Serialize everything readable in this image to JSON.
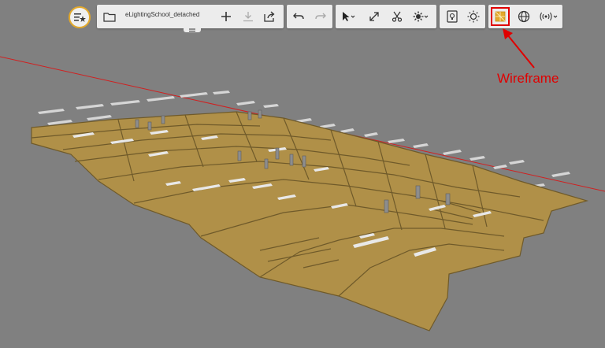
{
  "document": {
    "name": "eLightingSchool_detached"
  },
  "annotation": {
    "label": "Wireframe"
  },
  "colors": {
    "background": "#808080",
    "floor": "#b09048",
    "floor_edge": "#6f5a2a",
    "toolbar": "#ececec",
    "accent": "#e3a92b",
    "highlight": "#e00000"
  },
  "toolbar": {
    "menu": {
      "icon": "menu-star-icon"
    },
    "file": [
      "folder-icon",
      "add-icon",
      "download-icon",
      "export-icon"
    ],
    "edit": [
      "undo-icon",
      "redo-icon"
    ],
    "tools": [
      "select-pointer-icon",
      "resize-icon",
      "cut-icon",
      "settings-dropdown-icon"
    ],
    "view": [
      "light-panel-icon",
      "sun-icon"
    ],
    "render": [
      "wireframe-icon",
      "globe-icon",
      "signal-dropdown-icon"
    ]
  }
}
